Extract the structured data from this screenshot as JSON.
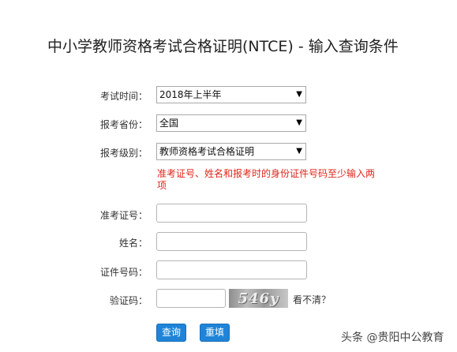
{
  "page": {
    "title": "中小学教师资格考试合格证明(NTCE) - 输入查询条件"
  },
  "form": {
    "exam_time": {
      "label": "考试时间：",
      "value": "2018年上半年"
    },
    "province": {
      "label": "报考省份：",
      "value": "全国"
    },
    "level": {
      "label": "报考级别：",
      "value": "教师资格考试合格证明"
    },
    "hint": "准考证号、姓名和报考时的身份证件号码至少输入两项",
    "admission_no": {
      "label": "准考证号：",
      "value": ""
    },
    "name": {
      "label": "姓名：",
      "value": ""
    },
    "id_no": {
      "label": "证件号码：",
      "value": ""
    },
    "captcha": {
      "label": "验证码：",
      "value": "",
      "image_text": "546y",
      "refresh": "看不清？"
    }
  },
  "buttons": {
    "query": "查询",
    "reset": "重填"
  },
  "watermark": "头条 @贵阳中公教育",
  "colors": {
    "button": "#1f84d8",
    "hint": "#e0261a"
  }
}
